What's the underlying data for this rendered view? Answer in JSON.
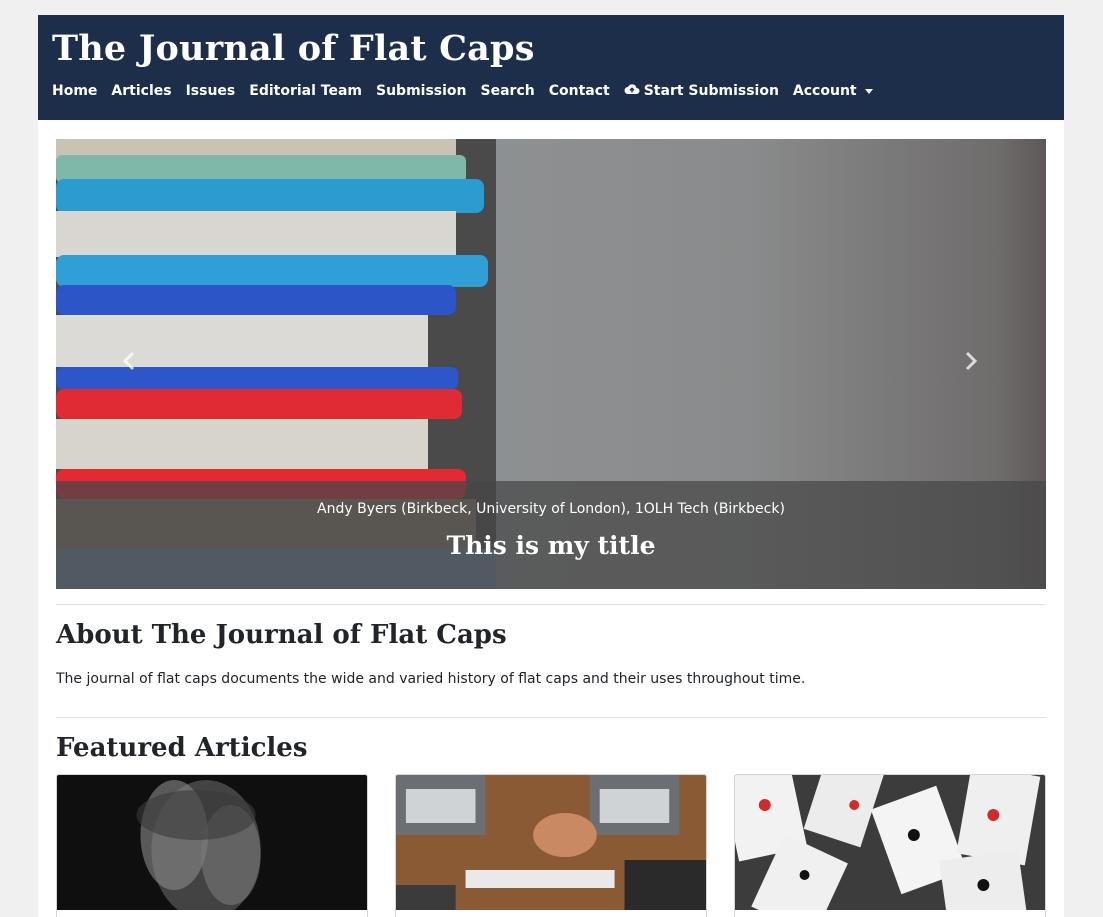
{
  "header": {
    "title": "The Journal of Flat Caps",
    "nav": [
      {
        "label": "Home"
      },
      {
        "label": "Articles"
      },
      {
        "label": "Issues"
      },
      {
        "label": "Editorial Team"
      },
      {
        "label": "Submission"
      },
      {
        "label": "Search"
      },
      {
        "label": "Contact"
      },
      {
        "label": "Start Submission",
        "icon": "cloud-upload-icon"
      },
      {
        "label": "Account",
        "icon": "caret-down-icon"
      }
    ]
  },
  "carousel": {
    "authors": "Andy Byers (Birkbeck, University of London), 1OLH Tech (Birkbeck)",
    "title": "This is my title",
    "prev_icon": "chevron-left-icon",
    "next_icon": "chevron-right-icon"
  },
  "about": {
    "title": "About The Journal of Flat Caps",
    "text": "The journal of flat caps documents the wide and varied history of flat caps and their uses throughout time."
  },
  "featured": {
    "title": "Featured Articles",
    "cards": [
      {
        "image": "blurred-portrait"
      },
      {
        "image": "team-fist-bump"
      },
      {
        "image": "playing-cards"
      }
    ]
  },
  "colors": {
    "header_bg": "#1c2e4a",
    "page_bg": "#f0f0f0"
  }
}
